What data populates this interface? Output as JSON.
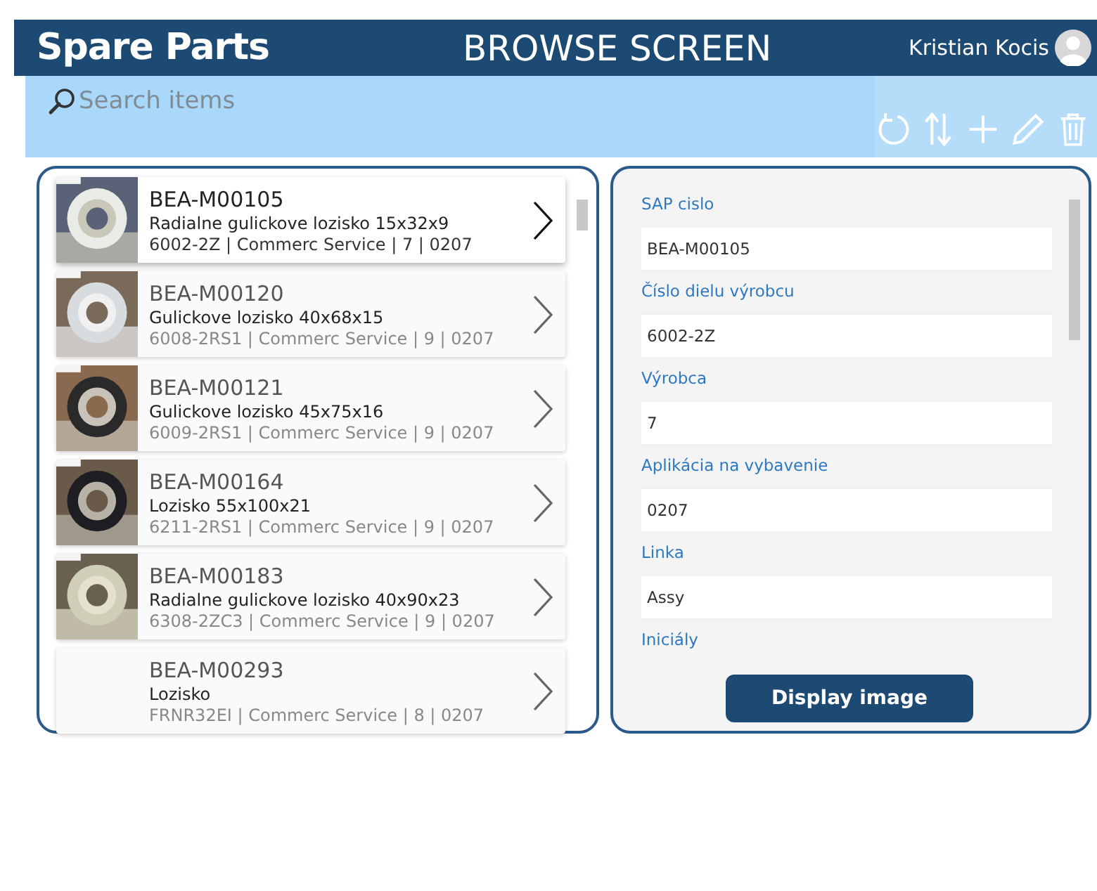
{
  "header": {
    "title": "Spare Parts",
    "screen_title": "BROWSE SCREEN",
    "user": "Kristian Kocis"
  },
  "search": {
    "placeholder": "Search items"
  },
  "toolbar": [
    {
      "kind": "refresh"
    },
    {
      "kind": "sort"
    },
    {
      "kind": "add"
    },
    {
      "kind": "edit"
    },
    {
      "kind": "delete"
    }
  ],
  "items": [
    {
      "code": "BEA-M00105",
      "name": "Radialne gulickove lozisko 15x32x9",
      "details": "6002-2Z | Commerc Service | 7 | 0207",
      "selected": true
    },
    {
      "code": "BEA-M00120",
      "name": "Gulickove lozisko 40x68x15",
      "details": "6008-2RS1 | Commerc Service | 9 | 0207",
      "selected": false
    },
    {
      "code": "BEA-M00121",
      "name": "Gulickove lozisko 45x75x16",
      "details": "6009-2RS1 | Commerc Service | 9 | 0207",
      "selected": false
    },
    {
      "code": "BEA-M00164",
      "name": "Lozisko 55x100x21",
      "details": "6211-2RS1 | Commerc Service | 9 | 0207",
      "selected": false
    },
    {
      "code": "BEA-M00183",
      "name": "Radialne gulickove lozisko 40x90x23",
      "details": "6308-2ZC3 | Commerc Service | 9 | 0207",
      "selected": false
    },
    {
      "code": "BEA-M00293",
      "name": "Lozisko",
      "details": "FRNR32EI | Commerc Service | 8 | 0207",
      "selected": false
    }
  ],
  "detail_fields": [
    {
      "label": "SAP cislo",
      "value": "BEA-M00105"
    },
    {
      "label": "Číslo dielu výrobcu",
      "value": "6002-2Z"
    },
    {
      "label": "Výrobca",
      "value": "7"
    },
    {
      "label": "Aplikácia na vybavenie",
      "value": "0207"
    },
    {
      "label": "Linka",
      "value": "Assy"
    },
    {
      "label": "Iniciály"
    }
  ],
  "display_button": "Display image"
}
